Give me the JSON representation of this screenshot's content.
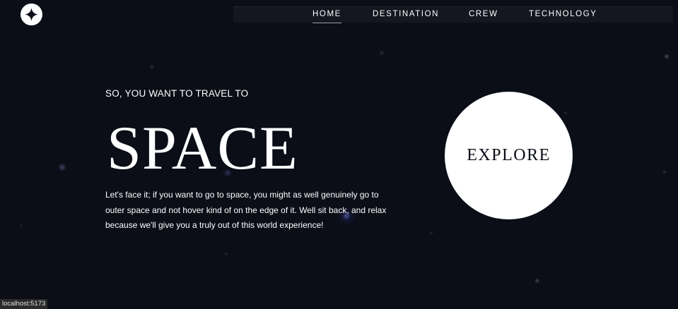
{
  "nav": {
    "items": [
      {
        "label": "HOME",
        "active": true
      },
      {
        "label": "DESTINATION",
        "active": false
      },
      {
        "label": "CREW",
        "active": false
      },
      {
        "label": "TECHNOLOGY",
        "active": false
      }
    ]
  },
  "hero": {
    "intro": "SO, YOU WANT TO TRAVEL TO",
    "title": "SPACE",
    "description": "Let's face it; if you want to go to space, you might as well genuinely go to outer space and not hover kind of on the edge of it. Well sit back, and relax because we'll give you a truly out of this world experience!",
    "explore_label": "EXPLORE"
  },
  "status_bar": {
    "url": "localhost:5173"
  },
  "icons": {
    "logo": "star-logo-icon"
  },
  "colors": {
    "background": "#0b0d17",
    "text": "#ffffff",
    "button": "#ffffff"
  }
}
